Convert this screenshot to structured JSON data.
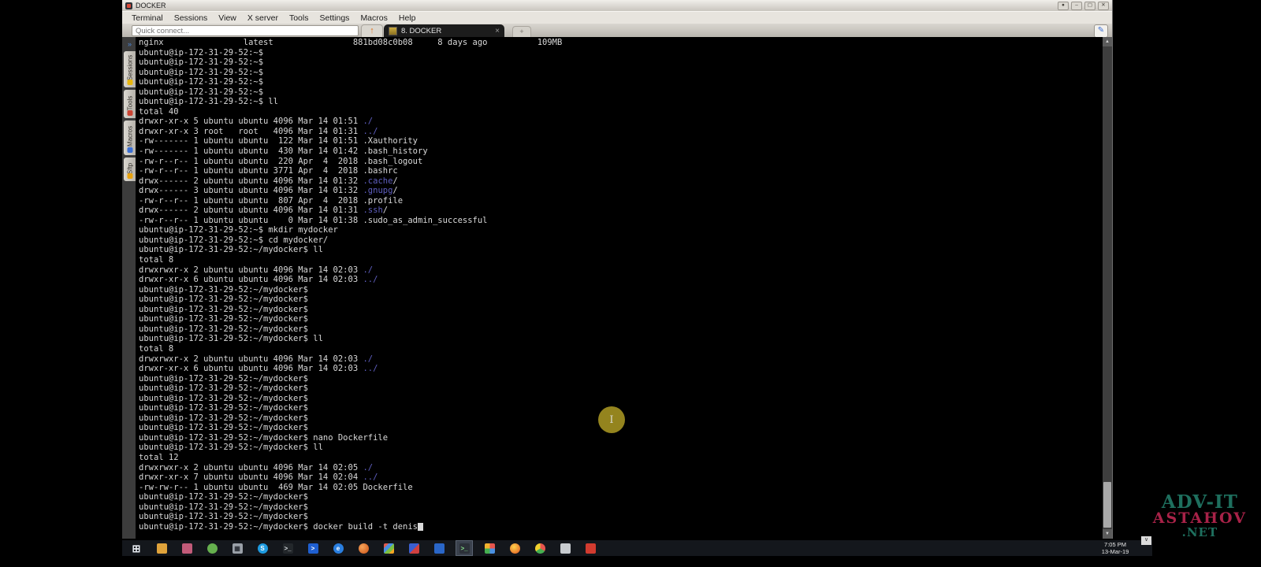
{
  "window": {
    "title": "DOCKER",
    "menu": [
      "Terminal",
      "Sessions",
      "View",
      "X server",
      "Tools",
      "Settings",
      "Macros",
      "Help"
    ],
    "quick_connect_placeholder": "Quick connect...",
    "toolbar": {
      "up_arrow_glyph": "↑",
      "new_tab_glyph": "+",
      "pencil_glyph": "✎"
    },
    "tab": {
      "label": "8. DOCKER",
      "close_glyph": "×"
    },
    "controls": {
      "pin": "●",
      "minimize": "–",
      "maximize": "▢",
      "close": "✕"
    }
  },
  "sidebar": {
    "collapse_glyph": "»",
    "tabs": [
      {
        "label": "Sessions",
        "icon": "star-icon",
        "icon_color": "#e8b60f"
      },
      {
        "label": "Tools",
        "icon": "tools-icon",
        "icon_color": "#cc4433"
      },
      {
        "label": "Macros",
        "icon": "pencil-icon",
        "icon_color": "#3b6fd4"
      },
      {
        "label": "Sftp",
        "icon": "folder-icon",
        "icon_color": "#e8a20f"
      }
    ]
  },
  "terminal": {
    "colors": {
      "foreground": "#d9d9d9",
      "directory": "#5f5fc0",
      "background": "#000000"
    },
    "scrollbar": {
      "up_glyph": "▲",
      "down_glyph": "▼"
    },
    "lines": [
      [
        [
          "nginx                latest                881bd08c0b08     8 days ago          109MB",
          "f"
        ]
      ],
      [
        [
          "ubuntu@ip-172-31-29-52:~$",
          "f"
        ]
      ],
      [
        [
          "ubuntu@ip-172-31-29-52:~$",
          "f"
        ]
      ],
      [
        [
          "ubuntu@ip-172-31-29-52:~$",
          "f"
        ]
      ],
      [
        [
          "ubuntu@ip-172-31-29-52:~$",
          "f"
        ]
      ],
      [
        [
          "ubuntu@ip-172-31-29-52:~$",
          "f"
        ]
      ],
      [
        [
          "ubuntu@ip-172-31-29-52:~$ ll",
          "f"
        ]
      ],
      [
        [
          "total 40",
          "f"
        ]
      ],
      [
        [
          "drwxr-xr-x 5 ubuntu ubuntu 4096 Mar 14 01:51 ",
          "f"
        ],
        [
          "./",
          "d"
        ]
      ],
      [
        [
          "drwxr-xr-x 3 root   root   4096 Mar 14 01:31 ",
          "f"
        ],
        [
          "../",
          "d"
        ]
      ],
      [
        [
          "-rw------- 1 ubuntu ubuntu  122 Mar 14 01:51 .Xauthority",
          "f"
        ]
      ],
      [
        [
          "-rw------- 1 ubuntu ubuntu  430 Mar 14 01:42 .bash_history",
          "f"
        ]
      ],
      [
        [
          "-rw-r--r-- 1 ubuntu ubuntu  220 Apr  4  2018 .bash_logout",
          "f"
        ]
      ],
      [
        [
          "-rw-r--r-- 1 ubuntu ubuntu 3771 Apr  4  2018 .bashrc",
          "f"
        ]
      ],
      [
        [
          "drwx------ 2 ubuntu ubuntu 4096 Mar 14 01:32 ",
          "f"
        ],
        [
          ".cache",
          "d"
        ],
        [
          "/",
          "f"
        ]
      ],
      [
        [
          "drwx------ 3 ubuntu ubuntu 4096 Mar 14 01:32 ",
          "f"
        ],
        [
          ".gnupg",
          "d"
        ],
        [
          "/",
          "f"
        ]
      ],
      [
        [
          "-rw-r--r-- 1 ubuntu ubuntu  807 Apr  4  2018 .profile",
          "f"
        ]
      ],
      [
        [
          "drwx------ 2 ubuntu ubuntu 4096 Mar 14 01:31 ",
          "f"
        ],
        [
          ".ssh",
          "d"
        ],
        [
          "/",
          "f"
        ]
      ],
      [
        [
          "-rw-r--r-- 1 ubuntu ubuntu    0 Mar 14 01:38 .sudo_as_admin_successful",
          "f"
        ]
      ],
      [
        [
          "ubuntu@ip-172-31-29-52:~$ mkdir mydocker",
          "f"
        ]
      ],
      [
        [
          "ubuntu@ip-172-31-29-52:~$ cd mydocker/",
          "f"
        ]
      ],
      [
        [
          "ubuntu@ip-172-31-29-52:~/mydocker$ ll",
          "f"
        ]
      ],
      [
        [
          "total 8",
          "f"
        ]
      ],
      [
        [
          "drwxrwxr-x 2 ubuntu ubuntu 4096 Mar 14 02:03 ",
          "f"
        ],
        [
          "./",
          "d"
        ]
      ],
      [
        [
          "drwxr-xr-x 6 ubuntu ubuntu 4096 Mar 14 02:03 ",
          "f"
        ],
        [
          "../",
          "d"
        ]
      ],
      [
        [
          "ubuntu@ip-172-31-29-52:~/mydocker$",
          "f"
        ]
      ],
      [
        [
          "ubuntu@ip-172-31-29-52:~/mydocker$",
          "f"
        ]
      ],
      [
        [
          "ubuntu@ip-172-31-29-52:~/mydocker$",
          "f"
        ]
      ],
      [
        [
          "ubuntu@ip-172-31-29-52:~/mydocker$",
          "f"
        ]
      ],
      [
        [
          "ubuntu@ip-172-31-29-52:~/mydocker$",
          "f"
        ]
      ],
      [
        [
          "ubuntu@ip-172-31-29-52:~/mydocker$ ll",
          "f"
        ]
      ],
      [
        [
          "total 8",
          "f"
        ]
      ],
      [
        [
          "drwxrwxr-x 2 ubuntu ubuntu 4096 Mar 14 02:03 ",
          "f"
        ],
        [
          "./",
          "d"
        ]
      ],
      [
        [
          "drwxr-xr-x 6 ubuntu ubuntu 4096 Mar 14 02:03 ",
          "f"
        ],
        [
          "../",
          "d"
        ]
      ],
      [
        [
          "ubuntu@ip-172-31-29-52:~/mydocker$",
          "f"
        ]
      ],
      [
        [
          "ubuntu@ip-172-31-29-52:~/mydocker$",
          "f"
        ]
      ],
      [
        [
          "ubuntu@ip-172-31-29-52:~/mydocker$",
          "f"
        ]
      ],
      [
        [
          "ubuntu@ip-172-31-29-52:~/mydocker$",
          "f"
        ]
      ],
      [
        [
          "ubuntu@ip-172-31-29-52:~/mydocker$",
          "f"
        ]
      ],
      [
        [
          "ubuntu@ip-172-31-29-52:~/mydocker$",
          "f"
        ]
      ],
      [
        [
          "ubuntu@ip-172-31-29-52:~/mydocker$ nano Dockerfile",
          "f"
        ]
      ],
      [
        [
          "ubuntu@ip-172-31-29-52:~/mydocker$ ll",
          "f"
        ]
      ],
      [
        [
          "total 12",
          "f"
        ]
      ],
      [
        [
          "drwxrwxr-x 2 ubuntu ubuntu 4096 Mar 14 02:05 ",
          "f"
        ],
        [
          "./",
          "d"
        ]
      ],
      [
        [
          "drwxr-xr-x 7 ubuntu ubuntu 4096 Mar 14 02:04 ",
          "f"
        ],
        [
          "../",
          "d"
        ]
      ],
      [
        [
          "-rw-rw-r-- 1 ubuntu ubuntu  469 Mar 14 02:05 Dockerfile",
          "f"
        ]
      ],
      [
        [
          "ubuntu@ip-172-31-29-52:~/mydocker$",
          "f"
        ]
      ],
      [
        [
          "ubuntu@ip-172-31-29-52:~/mydocker$",
          "f"
        ]
      ],
      [
        [
          "ubuntu@ip-172-31-29-52:~/mydocker$",
          "f"
        ]
      ],
      [
        [
          "ubuntu@ip-172-31-29-52:~/mydocker$ docker build -t denis",
          "f"
        ],
        [
          " ",
          "c"
        ]
      ]
    ]
  },
  "cursor_highlight": {
    "glyph": "I",
    "color": "#94841e",
    "glyph_color": "#d8d8cc"
  },
  "watermark": {
    "line1": "ADV-IT",
    "line2": "ASTAHOV",
    "line3": ".NET",
    "teal": "#1e6f5e",
    "crimson": "#a82248"
  },
  "taskbar": {
    "clock": {
      "time": "7:05 PM",
      "date": "13-Mar-19"
    },
    "hidden_icons_glyph": "∨",
    "icons": [
      {
        "name": "start-button",
        "glyph": "⊞",
        "fg": "#e8ecf2",
        "bg": "none",
        "shape": "start"
      },
      {
        "name": "file-explorer-icon",
        "glyph": "",
        "fg": "#fff",
        "bg": "#e0a33b",
        "shape": "square"
      },
      {
        "name": "photo-viewer-icon",
        "glyph": "",
        "fg": "#fff",
        "bg": "#c25b79",
        "shape": "square"
      },
      {
        "name": "green-globe-app-icon",
        "glyph": "",
        "fg": "#fff",
        "bg": "#66b04e",
        "shape": "circle"
      },
      {
        "name": "calculator-icon",
        "glyph": "▦",
        "fg": "#2c3038",
        "bg": "#9aa0a8",
        "shape": "square"
      },
      {
        "name": "skype-icon",
        "glyph": "S",
        "fg": "#ffffff",
        "bg": "#1e9be0",
        "shape": "circle"
      },
      {
        "name": "cmd-icon",
        "glyph": ">_",
        "fg": "#d8dde2",
        "bg": "#23272b",
        "shape": "square"
      },
      {
        "name": "powershell-icon",
        "glyph": ">",
        "fg": "#ffffff",
        "bg": "#1f5fd0",
        "shape": "square"
      },
      {
        "name": "internet-explorer-icon",
        "glyph": "e",
        "fg": "#ffffff",
        "bg": "#2a7fe0",
        "shape": "circle"
      },
      {
        "name": "firefox-sphere-icon",
        "glyph": "",
        "fg": "#fff",
        "bg": "radial-gradient(circle at 35% 35%, #f5a55a, #d86a2a 70%)",
        "shape": "circle"
      },
      {
        "name": "photos-app-icon",
        "glyph": "",
        "fg": "#fff",
        "bg": "linear-gradient(135deg,#e05a4e 25%,#4a90e2 25% 50%,#7bc043 50% 75%,#f5a623 75%)",
        "shape": "square"
      },
      {
        "name": "visual-app-icon",
        "glyph": "",
        "fg": "#fff",
        "bg": "linear-gradient(135deg,#3b5fd0 50%,#d04040 50%)",
        "shape": "square"
      },
      {
        "name": "document-app-icon",
        "glyph": "",
        "fg": "#fff",
        "bg": "#2a66c8",
        "shape": "square"
      },
      {
        "name": "mobaxterm-icon",
        "glyph": ">_",
        "fg": "#86e08a",
        "bg": "#2b3038",
        "shape": "square",
        "active": true
      },
      {
        "name": "office-grid-icon",
        "glyph": "",
        "fg": "#fff",
        "bg": "conic-gradient(#e8554d 0 25%,#4a90e2 0 50%,#46b050 0 75%,#f2b22e 0)",
        "shape": "square"
      },
      {
        "name": "firefox-icon",
        "glyph": "",
        "fg": "#fff",
        "bg": "radial-gradient(circle at 40% 35%,#ffd24a,#e8742c 75%)",
        "shape": "circle"
      },
      {
        "name": "chrome-icon",
        "glyph": "",
        "fg": "#fff",
        "bg": "conic-gradient(#e8554d 0 33%,#46b050 0 66%,#f2d22e 0)",
        "shape": "circle"
      },
      {
        "name": "notepad-icon",
        "glyph": "",
        "fg": "#555",
        "bg": "#c8ccd0",
        "shape": "square"
      },
      {
        "name": "recorder-icon",
        "glyph": "",
        "fg": "#fff",
        "bg": "#d23b2f",
        "shape": "square"
      }
    ]
  }
}
